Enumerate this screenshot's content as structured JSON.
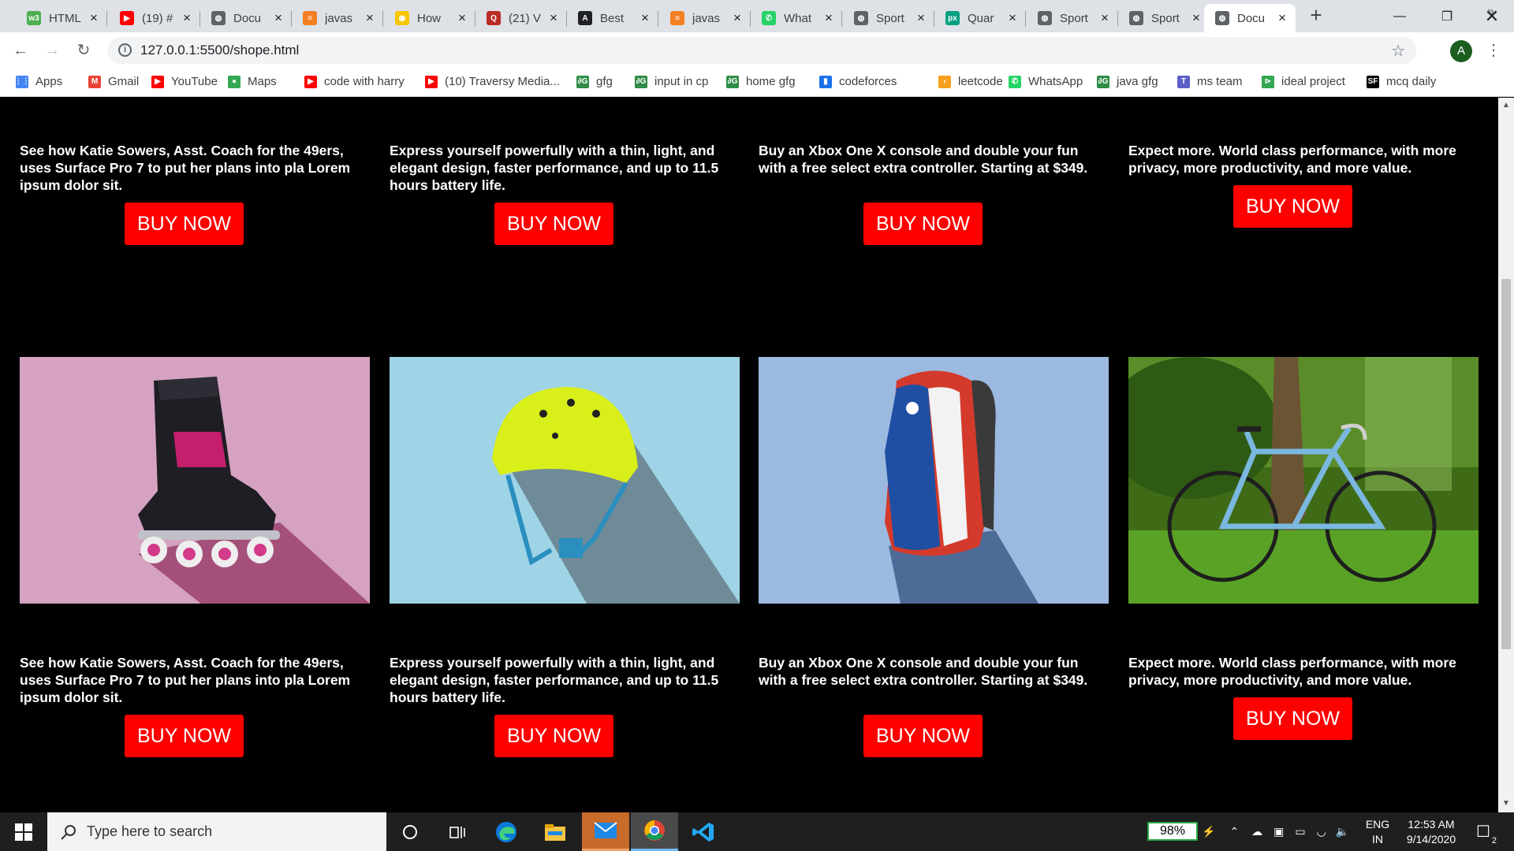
{
  "browser": {
    "tabs": [
      {
        "title": "HTML",
        "icon": "w3schools-icon",
        "color": "#4caf50",
        "glyph": "w3"
      },
      {
        "title": "(19) #",
        "icon": "youtube-icon",
        "color": "#ff0000",
        "glyph": "▶"
      },
      {
        "title": "Docu",
        "icon": "globe-icon",
        "color": "#5f6368",
        "glyph": "◍"
      },
      {
        "title": "javas",
        "icon": "stackoverflow-icon",
        "color": "#f48024",
        "glyph": "≡"
      },
      {
        "title": "How",
        "icon": "codegrepper-icon",
        "color": "#f7c600",
        "glyph": "◉"
      },
      {
        "title": "(21) V",
        "icon": "quora-icon",
        "color": "#b92b27",
        "glyph": "Q"
      },
      {
        "title": "Best",
        "icon": "angular-icon",
        "color": "#202124",
        "glyph": "A"
      },
      {
        "title": "javas",
        "icon": "stackoverflow-icon",
        "color": "#f48024",
        "glyph": "≡"
      },
      {
        "title": "What",
        "icon": "whatsapp-icon",
        "color": "#25d366",
        "glyph": "✆"
      },
      {
        "title": "Sport",
        "icon": "globe-icon",
        "color": "#5f6368",
        "glyph": "◍"
      },
      {
        "title": "Quar",
        "icon": "pexels-icon",
        "color": "#05a081",
        "glyph": "px"
      },
      {
        "title": "Sport",
        "icon": "globe-icon",
        "color": "#5f6368",
        "glyph": "◍"
      },
      {
        "title": "Sport",
        "icon": "globe-icon",
        "color": "#5f6368",
        "glyph": "◍"
      },
      {
        "title": "Docu",
        "icon": "globe-icon",
        "color": "#5f6368",
        "glyph": "◍",
        "active": true
      }
    ],
    "url": "127.0.0.1:5500/shope.html",
    "profile_initial": "A",
    "bookmarks": [
      {
        "label": "Apps",
        "icon": "apps-grid-icon",
        "color": "#4285f4",
        "glyph": "⋮⋮"
      },
      {
        "label": "Gmail",
        "icon": "gmail-icon",
        "color": "#ea4335",
        "glyph": "M"
      },
      {
        "label": "YouTube",
        "icon": "youtube-icon",
        "color": "#ff0000",
        "glyph": "▶"
      },
      {
        "label": "Maps",
        "icon": "maps-pin-icon",
        "color": "#34a853",
        "glyph": "●"
      },
      {
        "label": "code with harry",
        "icon": "youtube-icon",
        "color": "#ff0000",
        "glyph": "▶"
      },
      {
        "label": "(10) Traversy Media...",
        "icon": "youtube-icon",
        "color": "#ff0000",
        "glyph": "▶"
      },
      {
        "label": "gfg",
        "icon": "gfg-icon",
        "color": "#2f8d46",
        "glyph": "∂G"
      },
      {
        "label": "input in cp",
        "icon": "gfg-icon",
        "color": "#2f8d46",
        "glyph": "∂G"
      },
      {
        "label": "home gfg",
        "icon": "gfg-icon",
        "color": "#2f8d46",
        "glyph": "∂G"
      },
      {
        "label": "codeforces",
        "icon": "codeforces-icon",
        "color": "#1a73e8",
        "glyph": "▮"
      },
      {
        "label": "leetcode",
        "icon": "leetcode-icon",
        "color": "#f89f1b",
        "glyph": "‹"
      },
      {
        "label": "WhatsApp",
        "icon": "whatsapp-icon",
        "color": "#25d366",
        "glyph": "✆"
      },
      {
        "label": "java gfg",
        "icon": "gfg-icon",
        "color": "#2f8d46",
        "glyph": "∂G"
      },
      {
        "label": "ms team",
        "icon": "teams-icon",
        "color": "#5b5fc7",
        "glyph": "T"
      },
      {
        "label": "ideal project",
        "icon": "ideal-project-icon",
        "color": "#34a853",
        "glyph": "⊳"
      },
      {
        "label": "mcq daily",
        "icon": "sanfoundry-icon",
        "color": "#000000",
        "glyph": "SF"
      }
    ]
  },
  "page": {
    "cards_top": [
      {
        "text": "See how Katie Sowers, Asst. Coach for the 49ers, uses Surface Pro 7 to put her plans into pla Lorem ipsum dolor sit.",
        "button": "BUY NOW"
      },
      {
        "text": "Express yourself powerfully with a thin, light, and elegant design, faster performance, and up to 11.5 hours battery life.",
        "button": "BUY NOW"
      },
      {
        "text": "Buy an Xbox One X console and double your fun with a free select extra controller. Starting at $349.",
        "button": "BUY NOW"
      },
      {
        "text": "Expect more. World class performance, with more privacy, more productivity, and more value.",
        "button": "BUY NOW"
      }
    ],
    "products": [
      {
        "name": "inline-skate-image",
        "bg": "#d6a2c2"
      },
      {
        "name": "helmet-image",
        "bg": "#9fd3e6"
      },
      {
        "name": "backpack-image",
        "bg": "#9cb9e0"
      },
      {
        "name": "bicycle-image",
        "bg": "#4a7a1c"
      }
    ],
    "cards_bottom": [
      {
        "text": "See how Katie Sowers, Asst. Coach for the 49ers, uses Surface Pro 7 to put her plans into pla Lorem ipsum dolor sit.",
        "button": "BUY NOW"
      },
      {
        "text": "Express yourself powerfully with a thin, light, and elegant design, faster performance, and up to 11.5 hours battery life.",
        "button": "BUY NOW"
      },
      {
        "text": "Buy an Xbox One X console and double your fun with a free select extra controller. Starting at $349.",
        "button": "BUY NOW"
      },
      {
        "text": "Expect more. World class performance, with more privacy, more productivity, and more value.",
        "button": "BUY NOW"
      }
    ],
    "accent_color": "#ff0000"
  },
  "taskbar": {
    "search_placeholder": "Type here to search",
    "battery": "98%",
    "lang_top": "ENG",
    "lang_bottom": "IN",
    "time": "12:53 AM",
    "date": "9/14/2020",
    "notification_count": "2"
  }
}
